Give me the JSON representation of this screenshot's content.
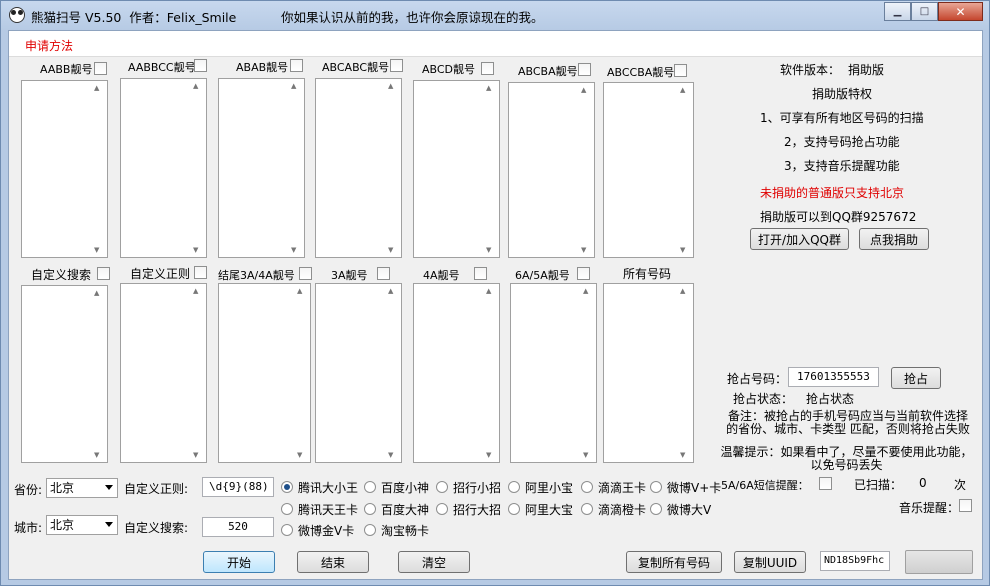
{
  "window": {
    "title": "熊猫扫号 V5.50  作者：Felix_Smile",
    "motto": "你如果认识从前的我，也许你会原谅现在的我。"
  },
  "menu": {
    "apply": "申请方法"
  },
  "categories_row1": [
    "AABB靓号",
    "AABBCC靓号",
    "ABAB靓号",
    "ABCABC靓号",
    "ABCD靓号",
    "ABCBA靓号",
    "ABCCBA靓号"
  ],
  "categories_row2": [
    "自定义搜索",
    "自定义正则",
    "结尾3A/4A靓号",
    "3A靓号",
    "4A靓号",
    "6A/5A靓号",
    "所有号码"
  ],
  "info": {
    "version_label": "软件版本：",
    "version_value": "捐助版",
    "privilege_title": "捐助版特权",
    "privilege_1": "1、可享有所有地区号码的扫描",
    "privilege_2": "2，支持号码抢占功能",
    "privilege_3": "3，支持音乐提醒功能",
    "warning": "未捐助的普通版只支持北京",
    "qq_group": "捐助版可以到QQ群9257672",
    "btn_qq": "打开/加入QQ群",
    "btn_donate": "点我捐助"
  },
  "grab": {
    "number_label": "抢占号码：",
    "number_value": "17601355553",
    "btn_grab": "抢占",
    "status_label": "抢占状态：",
    "status_value": "抢占状态",
    "note": "备注：被抢占的手机号码应当与当前软件选择的省份、城市、卡类型 匹配，否则将抢占失败",
    "tip": "温馨提示：如果看中了，尽量不要使用此功能，以免号码丢失",
    "sms_label": "5A/6A短信提醒：",
    "scanned_label": "已扫描：",
    "scanned_count": "0",
    "scanned_unit": "次",
    "music_label": "音乐提醒："
  },
  "filters": {
    "province_label": "省份:",
    "province_value": "北京",
    "city_label": "城市:",
    "city_value": "北京",
    "regex_label": "自定义正则:",
    "regex_value": "\\d{9}(88)",
    "search_label": "自定义搜索:",
    "search_value": "520"
  },
  "card_types": [
    "腾讯大小王",
    "百度小神",
    "招行小招",
    "阿里小宝",
    "滴滴王卡",
    "微博V+卡",
    "腾讯天王卡",
    "百度大神",
    "招行大招",
    "阿里大宝",
    "滴滴橙卡",
    "微博大V",
    "微博金V卡",
    "淘宝畅卡"
  ],
  "selected_card": "腾讯大小王",
  "actions": {
    "start": "开始",
    "stop": "结束",
    "clear": "清空",
    "copy_all": "复制所有号码",
    "copy_uuid": "复制UUID",
    "uuid_value": "ND18Sb9Fhc"
  }
}
